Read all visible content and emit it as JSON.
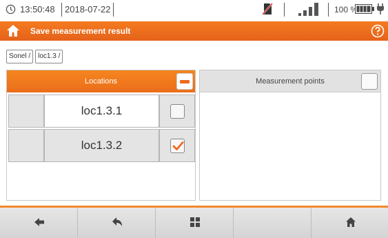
{
  "status": {
    "time": "13:50:48",
    "date": "2018-07-22",
    "battery_percent": "100 %",
    "battery_level": 1.0,
    "signal_bars": 4,
    "icons": [
      "clock-icon",
      "sd-card-crossed-icon",
      "signal-icon",
      "battery-icon",
      "plug-icon"
    ]
  },
  "titlebar": {
    "title": "Save measurement result",
    "icons": [
      "home-icon",
      "help-icon"
    ]
  },
  "breadcrumb": [
    {
      "label": "Sonel /"
    },
    {
      "label": "loc1.3 /"
    }
  ],
  "locations": {
    "header": "Locations",
    "items": [
      {
        "name": "loc1.3.1",
        "checked": false
      },
      {
        "name": "loc1.3.2",
        "checked": true
      }
    ]
  },
  "measurement_points": {
    "header": "Measurement points",
    "items": []
  },
  "toolbar": {
    "buttons": [
      "arrow-left-icon",
      "reply-icon",
      "grid-icon",
      "empty",
      "home-icon"
    ]
  },
  "colors": {
    "accent": "#ef6a1e",
    "panel_gray": "#e2e2e2"
  }
}
